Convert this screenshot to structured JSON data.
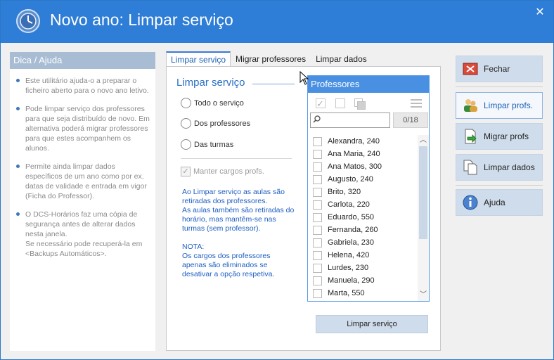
{
  "window": {
    "title": "Novo ano: Limpar serviço",
    "close_glyph": "✕"
  },
  "help": {
    "header": "Dica / Ajuda",
    "items": [
      "Este utilitário ajuda-o a preparar o ficheiro aberto para o novo ano letivo.",
      "Pode limpar serviço dos professores para que seja distribuído de novo. Em alternativa poderá migrar professores para que estes acompanhem os alunos.",
      "Permite ainda limpar dados específicos de um ano como por ex. datas de validade e entrada em vigor (Ficha do Professor).",
      "O DCS-Horários faz uma cópia de segurança antes de alterar dados nesta janela.\nSe necessário pode recuperá-la em <Backups Automáticos>."
    ]
  },
  "tabs": [
    {
      "label": "Limpar serviço",
      "active": true
    },
    {
      "label": "Migrar professores",
      "active": false
    },
    {
      "label": "Limpar dados",
      "active": false
    }
  ],
  "limpar": {
    "title": "Limpar serviço",
    "options": [
      "Todo o serviço",
      "Dos professores",
      "Das turmas"
    ],
    "keep_label": "Manter cargos profs.",
    "keep_checked": true,
    "info": "Ao Limpar serviço as aulas são retiradas dos professores.\nAs aulas também são retiradas do horário, mas mantêm-se nas turmas (sem professor).\n\nNOTA:\nOs cargos dos professores apenas são eliminados se desativar a opção respetiva.",
    "button": "Limpar serviço"
  },
  "professores": {
    "header": "Professores",
    "search_value": "",
    "count": "0/18",
    "items": [
      "Alexandra, 240",
      "Ana Maria, 240",
      "Ana Matos, 300",
      "Augusto, 240",
      "Brito, 320",
      "Carlota, 220",
      "Eduardo, 550",
      "Fernanda, 260",
      "Gabriela, 230",
      "Helena, 420",
      "Lurdes, 230",
      "Manuela, 290",
      "Marta, 550"
    ],
    "scroll_up": "︿",
    "scroll_down": "﹀"
  },
  "side": {
    "fechar": "Fechar",
    "limpar_profs": "Limpar profs.",
    "migrar_profs": "Migrar profs",
    "limpar_dados": "Limpar dados",
    "ajuda": "Ajuda"
  }
}
